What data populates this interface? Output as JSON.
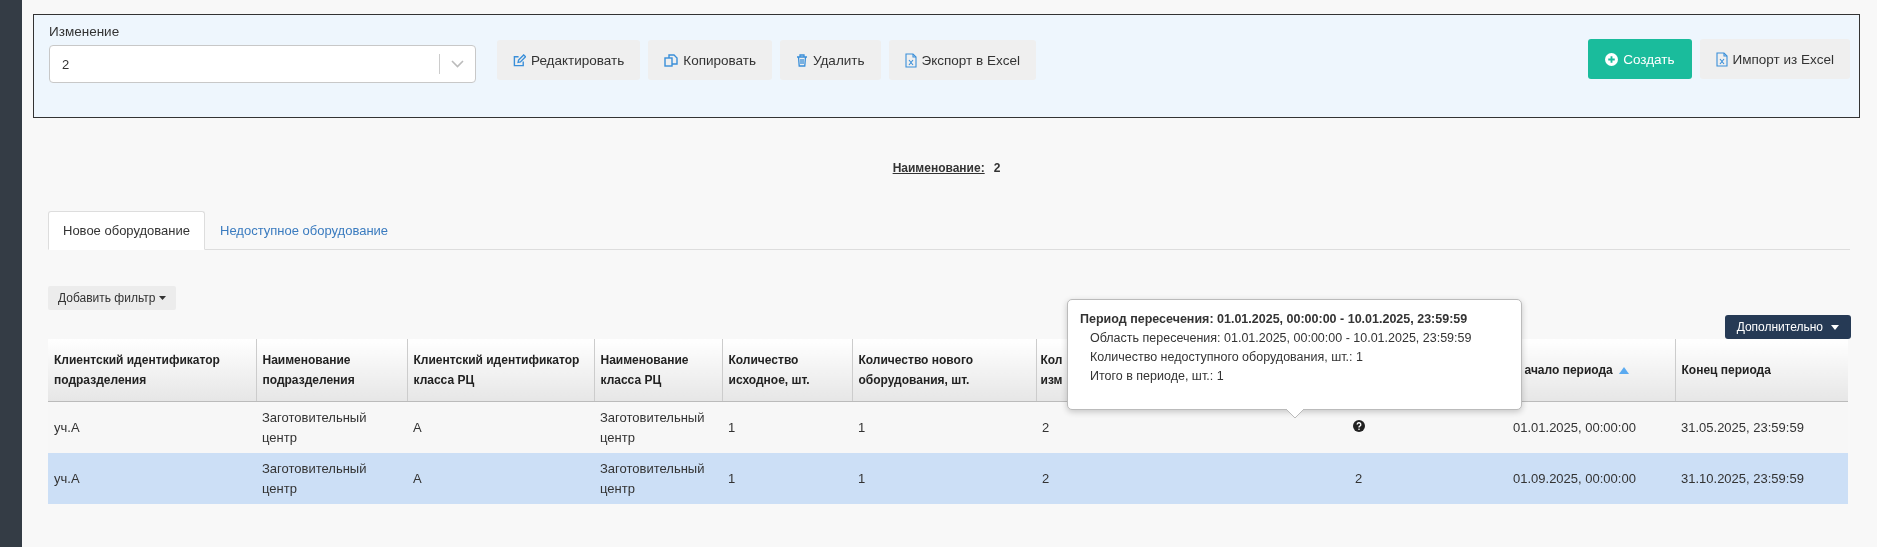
{
  "panel": {
    "field_label": "Изменение",
    "select_value": "2",
    "actions": [
      {
        "kind": "edit",
        "label": "Редактировать"
      },
      {
        "kind": "copy",
        "label": "Копировать"
      },
      {
        "kind": "delete",
        "label": "Удалить"
      },
      {
        "kind": "excel",
        "label": "Экспорт в Excel"
      }
    ],
    "right_actions": [
      {
        "kind": "create",
        "label": "Создать"
      },
      {
        "kind": "excel",
        "label": "Импорт из Excel"
      }
    ]
  },
  "name_label": "Наименование:",
  "name_value": "2",
  "tabs": [
    {
      "label": "Новое оборудование",
      "selected": true
    },
    {
      "label": "Недоступное оборудование",
      "selected": false
    }
  ],
  "filter_button": "Добавить фильтр",
  "more_button": "Дополнительно",
  "columns": [
    {
      "label": "Клиентский идентификатор подразделения"
    },
    {
      "label": "Наименование подразделения"
    },
    {
      "label": "Клиентский идентификатор класса РЦ"
    },
    {
      "label": "Наименование класса РЦ"
    },
    {
      "label": "Количество исходное, шт."
    },
    {
      "label": "Количество нового оборудования, шт."
    },
    {
      "label": "Кол\nизм"
    },
    {},
    {
      "label": "ачало периода",
      "sorted_ascending": true
    },
    {
      "label": "Конец периода"
    }
  ],
  "rows": [
    {
      "selected": false,
      "hint": true,
      "cells": [
        "уч.А",
        "Заготовительный центр",
        "А",
        "Заготовительный центр",
        "1",
        "1",
        "2",
        null,
        "01.01.2025, 00:00:00",
        "31.05.2025, 23:59:59"
      ]
    },
    {
      "selected": true,
      "hint": false,
      "cells": [
        "уч.А",
        "Заготовительный центр",
        "А",
        "Заготовительный центр",
        "1",
        "1",
        "2",
        "2",
        "01.09.2025, 00:00:00",
        "31.10.2025, 23:59:59"
      ]
    }
  ],
  "tooltip": {
    "title": "Период пересечения: 01.01.2025, 00:00:00 - 10.01.2025, 23:59:59",
    "lines": [
      "Область пересечения: 01.01.2025, 00:00:00 - 10.01.2025, 23:59:59",
      "Количество недоступного оборудования, шт.: 1",
      "Итого в периоде, шт.: 1"
    ]
  }
}
